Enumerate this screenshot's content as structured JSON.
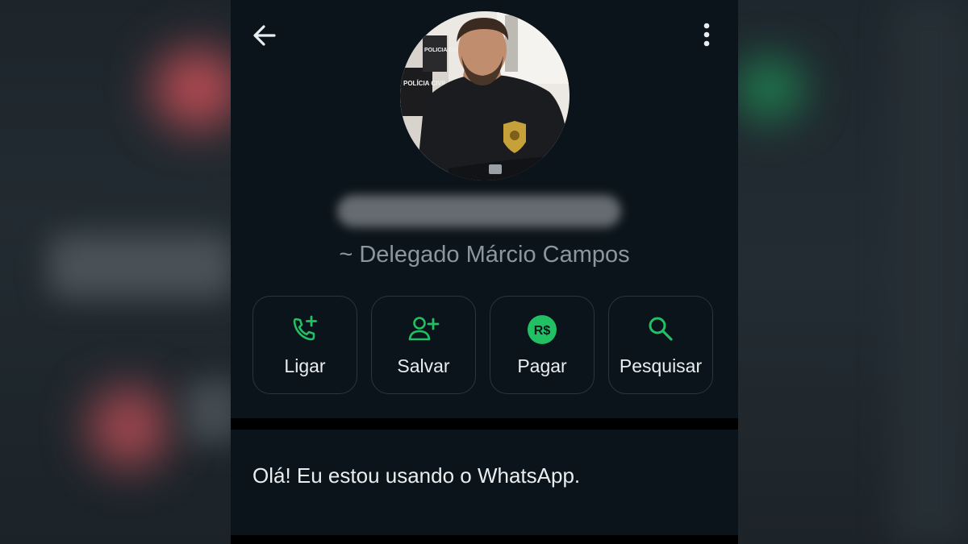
{
  "profile": {
    "subtitle": "~ Delegado Márcio Campos",
    "about": "Olá! Eu estou usando o WhatsApp."
  },
  "avatar": {
    "badge_text_1": "POLICIA CIVIL",
    "badge_text_2": "POLÍCIA CIVIL"
  },
  "actions": [
    {
      "label": "Ligar",
      "icon": "phone-plus-icon"
    },
    {
      "label": "Salvar",
      "icon": "add-user-icon"
    },
    {
      "label": "Pagar",
      "icon": "payment-icon",
      "icon_text": "R$"
    },
    {
      "label": "Pesquisar",
      "icon": "search-icon"
    }
  ],
  "colors": {
    "accent": "#21c063",
    "background": "#0b141a",
    "text_primary": "#e9edef",
    "text_secondary": "#8b979d"
  }
}
